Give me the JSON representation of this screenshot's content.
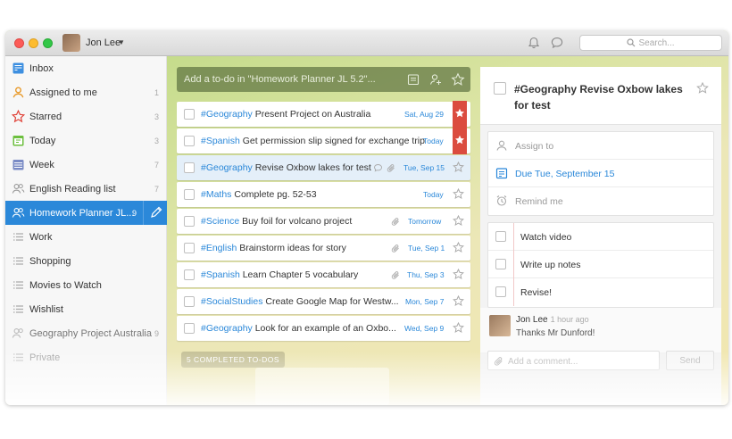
{
  "titlebar": {
    "user_name": "Jon Lee",
    "search_placeholder": "Search..."
  },
  "sidebar": {
    "items": [
      {
        "label": "Inbox",
        "count": "",
        "icon": "inbox-icon"
      },
      {
        "label": "Assigned to me",
        "count": "1",
        "icon": "person-icon"
      },
      {
        "label": "Starred",
        "count": "3",
        "icon": "star-icon"
      },
      {
        "label": "Today",
        "count": "3",
        "icon": "calendar-today-icon"
      },
      {
        "label": "Week",
        "count": "7",
        "icon": "calendar-week-icon"
      },
      {
        "label": "English Reading list",
        "count": "7",
        "icon": "shared-list-icon"
      },
      {
        "label": "Homework Planner JL...",
        "count": "9",
        "icon": "shared-list-icon"
      },
      {
        "label": "Work",
        "count": "",
        "icon": "list-icon"
      },
      {
        "label": "Shopping",
        "count": "",
        "icon": "list-icon"
      },
      {
        "label": "Movies to Watch",
        "count": "",
        "icon": "list-icon"
      },
      {
        "label": "Wishlist",
        "count": "",
        "icon": "list-icon"
      },
      {
        "label": "Geography Project Australia",
        "count": "9",
        "icon": "shared-list-icon"
      },
      {
        "label": "Private",
        "count": "",
        "icon": "list-icon"
      }
    ]
  },
  "add_todo": {
    "placeholder": "Add a to-do in \"Homework Planner JL 5.2\"..."
  },
  "tasks": [
    {
      "tag": "#Geography",
      "title": " Present Project on Australia",
      "date": "Sat, Aug 29",
      "starred": true
    },
    {
      "tag": "#Spanish",
      "title": " Get permission slip signed for exchange trip",
      "date": "Today",
      "starred": true
    },
    {
      "tag": "#Geography",
      "title": " Revise Oxbow lakes for test",
      "date": "Tue, Sep 15",
      "starred": false
    },
    {
      "tag": "#Maths",
      "title": " Complete pg. 52-53",
      "date": "Today",
      "starred": false
    },
    {
      "tag": "#Science",
      "title": " Buy foil for volcano project",
      "date": "Tomorrow",
      "starred": false
    },
    {
      "tag": "#English",
      "title": " Brainstorm ideas for story",
      "date": "Tue, Sep 1",
      "starred": false
    },
    {
      "tag": "#Spanish",
      "title": " Learn Chapter 5 vocabulary",
      "date": "Thu, Sep 3",
      "starred": false
    },
    {
      "tag": "#SocialStudies",
      "title": " Create Google Map for Westw...",
      "date": "Mon, Sep 7",
      "starred": false
    },
    {
      "tag": "#Geography",
      "title": " Look for an example of an Oxbo...",
      "date": "Wed, Sep 9",
      "starred": false
    }
  ],
  "completed_label": "5 COMPLETED TO-DOS",
  "detail": {
    "title": "#Geography Revise Oxbow lakes for test",
    "assign_label": "Assign to",
    "due_label": "Due Tue, September 15",
    "remind_label": "Remind me",
    "subtasks": [
      "Watch video",
      "Write up notes",
      "Revise!"
    ],
    "comment": {
      "author": "Jon Lee",
      "time": "1 hour ago",
      "text": "Thanks Mr Dunford!"
    },
    "comment_placeholder": "Add a comment...",
    "send_label": "Send"
  },
  "colors": {
    "accent": "#2b88d9",
    "flag": "#db4c3f"
  }
}
